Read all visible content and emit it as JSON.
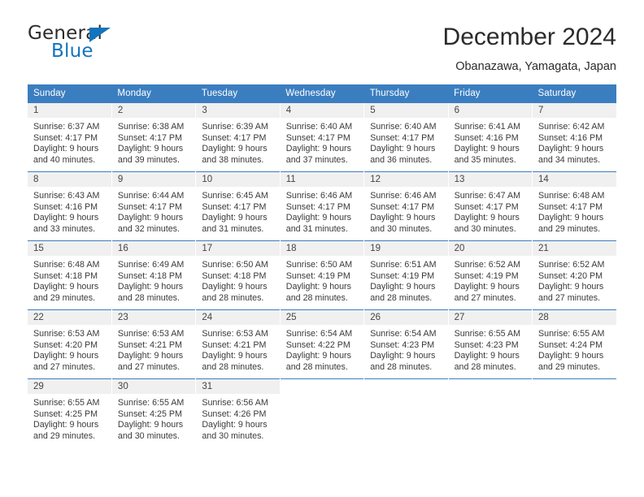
{
  "brand": {
    "name_top": "General",
    "name_bottom": "Blue",
    "triangle_color": "#1274bd"
  },
  "header": {
    "title": "December 2024",
    "location": "Obanazawa, Yamagata, Japan"
  },
  "theme": {
    "header_blue": "#3b7ec0",
    "daynum_bg": "#f0f0f0",
    "text": "#3a3a3a"
  },
  "weekday_headers": [
    "Sunday",
    "Monday",
    "Tuesday",
    "Wednesday",
    "Thursday",
    "Friday",
    "Saturday"
  ],
  "weeks": [
    [
      {
        "day": "1",
        "sunrise": "Sunrise: 6:37 AM",
        "sunset": "Sunset: 4:17 PM",
        "daylight1": "Daylight: 9 hours",
        "daylight2": "and 40 minutes."
      },
      {
        "day": "2",
        "sunrise": "Sunrise: 6:38 AM",
        "sunset": "Sunset: 4:17 PM",
        "daylight1": "Daylight: 9 hours",
        "daylight2": "and 39 minutes."
      },
      {
        "day": "3",
        "sunrise": "Sunrise: 6:39 AM",
        "sunset": "Sunset: 4:17 PM",
        "daylight1": "Daylight: 9 hours",
        "daylight2": "and 38 minutes."
      },
      {
        "day": "4",
        "sunrise": "Sunrise: 6:40 AM",
        "sunset": "Sunset: 4:17 PM",
        "daylight1": "Daylight: 9 hours",
        "daylight2": "and 37 minutes."
      },
      {
        "day": "5",
        "sunrise": "Sunrise: 6:40 AM",
        "sunset": "Sunset: 4:17 PM",
        "daylight1": "Daylight: 9 hours",
        "daylight2": "and 36 minutes."
      },
      {
        "day": "6",
        "sunrise": "Sunrise: 6:41 AM",
        "sunset": "Sunset: 4:16 PM",
        "daylight1": "Daylight: 9 hours",
        "daylight2": "and 35 minutes."
      },
      {
        "day": "7",
        "sunrise": "Sunrise: 6:42 AM",
        "sunset": "Sunset: 4:16 PM",
        "daylight1": "Daylight: 9 hours",
        "daylight2": "and 34 minutes."
      }
    ],
    [
      {
        "day": "8",
        "sunrise": "Sunrise: 6:43 AM",
        "sunset": "Sunset: 4:16 PM",
        "daylight1": "Daylight: 9 hours",
        "daylight2": "and 33 minutes."
      },
      {
        "day": "9",
        "sunrise": "Sunrise: 6:44 AM",
        "sunset": "Sunset: 4:17 PM",
        "daylight1": "Daylight: 9 hours",
        "daylight2": "and 32 minutes."
      },
      {
        "day": "10",
        "sunrise": "Sunrise: 6:45 AM",
        "sunset": "Sunset: 4:17 PM",
        "daylight1": "Daylight: 9 hours",
        "daylight2": "and 31 minutes."
      },
      {
        "day": "11",
        "sunrise": "Sunrise: 6:46 AM",
        "sunset": "Sunset: 4:17 PM",
        "daylight1": "Daylight: 9 hours",
        "daylight2": "and 31 minutes."
      },
      {
        "day": "12",
        "sunrise": "Sunrise: 6:46 AM",
        "sunset": "Sunset: 4:17 PM",
        "daylight1": "Daylight: 9 hours",
        "daylight2": "and 30 minutes."
      },
      {
        "day": "13",
        "sunrise": "Sunrise: 6:47 AM",
        "sunset": "Sunset: 4:17 PM",
        "daylight1": "Daylight: 9 hours",
        "daylight2": "and 30 minutes."
      },
      {
        "day": "14",
        "sunrise": "Sunrise: 6:48 AM",
        "sunset": "Sunset: 4:17 PM",
        "daylight1": "Daylight: 9 hours",
        "daylight2": "and 29 minutes."
      }
    ],
    [
      {
        "day": "15",
        "sunrise": "Sunrise: 6:48 AM",
        "sunset": "Sunset: 4:18 PM",
        "daylight1": "Daylight: 9 hours",
        "daylight2": "and 29 minutes."
      },
      {
        "day": "16",
        "sunrise": "Sunrise: 6:49 AM",
        "sunset": "Sunset: 4:18 PM",
        "daylight1": "Daylight: 9 hours",
        "daylight2": "and 28 minutes."
      },
      {
        "day": "17",
        "sunrise": "Sunrise: 6:50 AM",
        "sunset": "Sunset: 4:18 PM",
        "daylight1": "Daylight: 9 hours",
        "daylight2": "and 28 minutes."
      },
      {
        "day": "18",
        "sunrise": "Sunrise: 6:50 AM",
        "sunset": "Sunset: 4:19 PM",
        "daylight1": "Daylight: 9 hours",
        "daylight2": "and 28 minutes."
      },
      {
        "day": "19",
        "sunrise": "Sunrise: 6:51 AM",
        "sunset": "Sunset: 4:19 PM",
        "daylight1": "Daylight: 9 hours",
        "daylight2": "and 28 minutes."
      },
      {
        "day": "20",
        "sunrise": "Sunrise: 6:52 AM",
        "sunset": "Sunset: 4:19 PM",
        "daylight1": "Daylight: 9 hours",
        "daylight2": "and 27 minutes."
      },
      {
        "day": "21",
        "sunrise": "Sunrise: 6:52 AM",
        "sunset": "Sunset: 4:20 PM",
        "daylight1": "Daylight: 9 hours",
        "daylight2": "and 27 minutes."
      }
    ],
    [
      {
        "day": "22",
        "sunrise": "Sunrise: 6:53 AM",
        "sunset": "Sunset: 4:20 PM",
        "daylight1": "Daylight: 9 hours",
        "daylight2": "and 27 minutes."
      },
      {
        "day": "23",
        "sunrise": "Sunrise: 6:53 AM",
        "sunset": "Sunset: 4:21 PM",
        "daylight1": "Daylight: 9 hours",
        "daylight2": "and 27 minutes."
      },
      {
        "day": "24",
        "sunrise": "Sunrise: 6:53 AM",
        "sunset": "Sunset: 4:21 PM",
        "daylight1": "Daylight: 9 hours",
        "daylight2": "and 28 minutes."
      },
      {
        "day": "25",
        "sunrise": "Sunrise: 6:54 AM",
        "sunset": "Sunset: 4:22 PM",
        "daylight1": "Daylight: 9 hours",
        "daylight2": "and 28 minutes."
      },
      {
        "day": "26",
        "sunrise": "Sunrise: 6:54 AM",
        "sunset": "Sunset: 4:23 PM",
        "daylight1": "Daylight: 9 hours",
        "daylight2": "and 28 minutes."
      },
      {
        "day": "27",
        "sunrise": "Sunrise: 6:55 AM",
        "sunset": "Sunset: 4:23 PM",
        "daylight1": "Daylight: 9 hours",
        "daylight2": "and 28 minutes."
      },
      {
        "day": "28",
        "sunrise": "Sunrise: 6:55 AM",
        "sunset": "Sunset: 4:24 PM",
        "daylight1": "Daylight: 9 hours",
        "daylight2": "and 29 minutes."
      }
    ],
    [
      {
        "day": "29",
        "sunrise": "Sunrise: 6:55 AM",
        "sunset": "Sunset: 4:25 PM",
        "daylight1": "Daylight: 9 hours",
        "daylight2": "and 29 minutes."
      },
      {
        "day": "30",
        "sunrise": "Sunrise: 6:55 AM",
        "sunset": "Sunset: 4:25 PM",
        "daylight1": "Daylight: 9 hours",
        "daylight2": "and 30 minutes."
      },
      {
        "day": "31",
        "sunrise": "Sunrise: 6:56 AM",
        "sunset": "Sunset: 4:26 PM",
        "daylight1": "Daylight: 9 hours",
        "daylight2": "and 30 minutes."
      },
      {
        "day": "",
        "sunrise": "",
        "sunset": "",
        "daylight1": "",
        "daylight2": ""
      },
      {
        "day": "",
        "sunrise": "",
        "sunset": "",
        "daylight1": "",
        "daylight2": ""
      },
      {
        "day": "",
        "sunrise": "",
        "sunset": "",
        "daylight1": "",
        "daylight2": ""
      },
      {
        "day": "",
        "sunrise": "",
        "sunset": "",
        "daylight1": "",
        "daylight2": ""
      }
    ]
  ]
}
